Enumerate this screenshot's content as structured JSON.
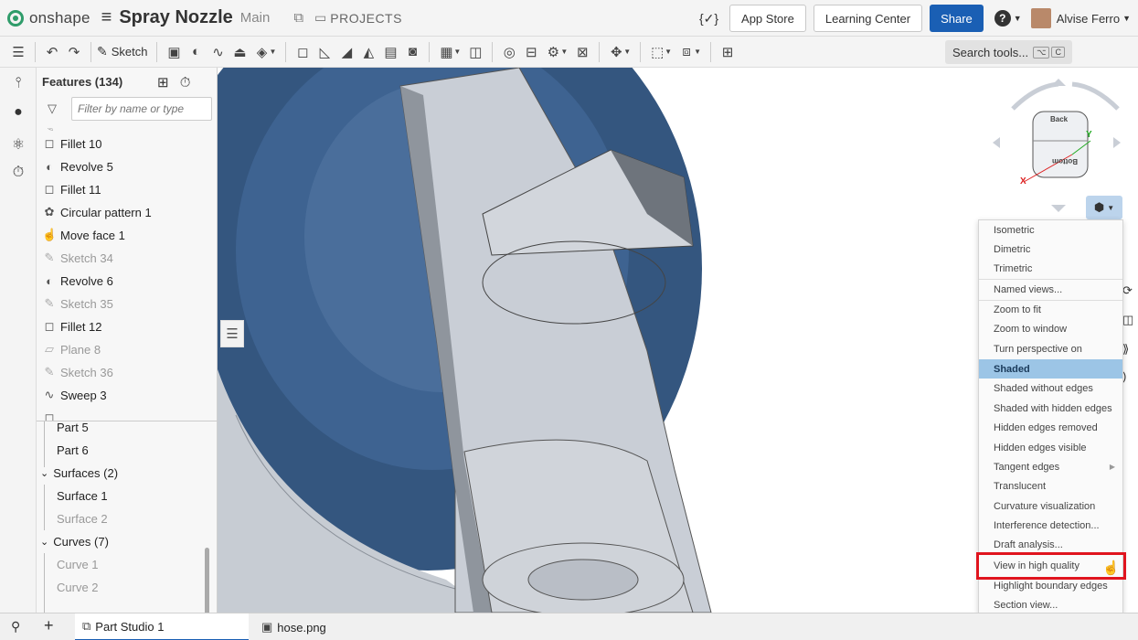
{
  "topbar": {
    "logo_text": "onshape",
    "document_title": "Spray Nozzle",
    "branch": "Main",
    "projects": "PROJECTS",
    "version_icon": "{✓}",
    "app_store": "App Store",
    "learning_center": "Learning Center",
    "share": "Share",
    "help": "?",
    "user_name": "Alvise Ferro"
  },
  "toolbar": {
    "sketch_label": "Sketch",
    "search_tools": "Search tools...",
    "search_shortcut_1": "⌥",
    "search_shortcut_2": "C"
  },
  "panel": {
    "title": "Features (134)",
    "filter_placeholder": "Filter by name or type",
    "features": [
      {
        "label": "Fillet 10",
        "icon": "fillet-icon",
        "dim": false
      },
      {
        "label": "Revolve 5",
        "icon": "revolve-icon",
        "dim": false
      },
      {
        "label": "Fillet 11",
        "icon": "fillet-icon",
        "dim": false
      },
      {
        "label": "Circular pattern 1",
        "icon": "circular-pattern-icon",
        "dim": false
      },
      {
        "label": "Move face 1",
        "icon": "move-face-icon",
        "dim": false
      },
      {
        "label": "Sketch 34",
        "icon": "sketch-icon",
        "dim": true
      },
      {
        "label": "Revolve 6",
        "icon": "revolve-icon",
        "dim": false
      },
      {
        "label": "Sketch 35",
        "icon": "sketch-icon",
        "dim": true
      },
      {
        "label": "Fillet 12",
        "icon": "fillet-icon",
        "dim": false
      },
      {
        "label": "Plane 8",
        "icon": "plane-icon",
        "dim": true
      },
      {
        "label": "Sketch 36",
        "icon": "sketch-icon",
        "dim": true
      },
      {
        "label": "Sweep 3",
        "icon": "sweep-icon",
        "dim": false
      }
    ],
    "parts": {
      "part5": "Part 5",
      "part6": "Part 6",
      "surfaces": "Surfaces (2)",
      "surface1": "Surface 1",
      "surface2": "Surface 2",
      "curves": "Curves (7)",
      "curve1": "Curve 1",
      "curve2": "Curve 2"
    }
  },
  "viewcube": {
    "back": "Back",
    "bottom": "Bottom",
    "x_axis": "X",
    "y_axis": "Y"
  },
  "view_menu": {
    "items": [
      "Isometric",
      "Dimetric",
      "Trimetric",
      "Named views...",
      "Zoom to fit",
      "Zoom to window",
      "Turn perspective on",
      "Shaded",
      "Shaded without edges",
      "Shaded with hidden edges",
      "Hidden edges removed",
      "Hidden edges visible",
      "Tangent edges",
      "Translucent",
      "Curvature visualization",
      "Interference detection...",
      "Draft analysis...",
      "View in high quality",
      "Highlight boundary edges",
      "Section view..."
    ],
    "selected": "Shaded",
    "highlighted": "View in high quality"
  },
  "bottombar": {
    "tab_part_studio": "Part Studio 1",
    "tab_image": "hose.png"
  },
  "colors": {
    "accent": "#1a5fb4",
    "model_blue": "#3d5f86",
    "model_gray": "#c9ced6",
    "menu_selected": "#9cc5e6",
    "highlight_red": "#e0141e"
  }
}
